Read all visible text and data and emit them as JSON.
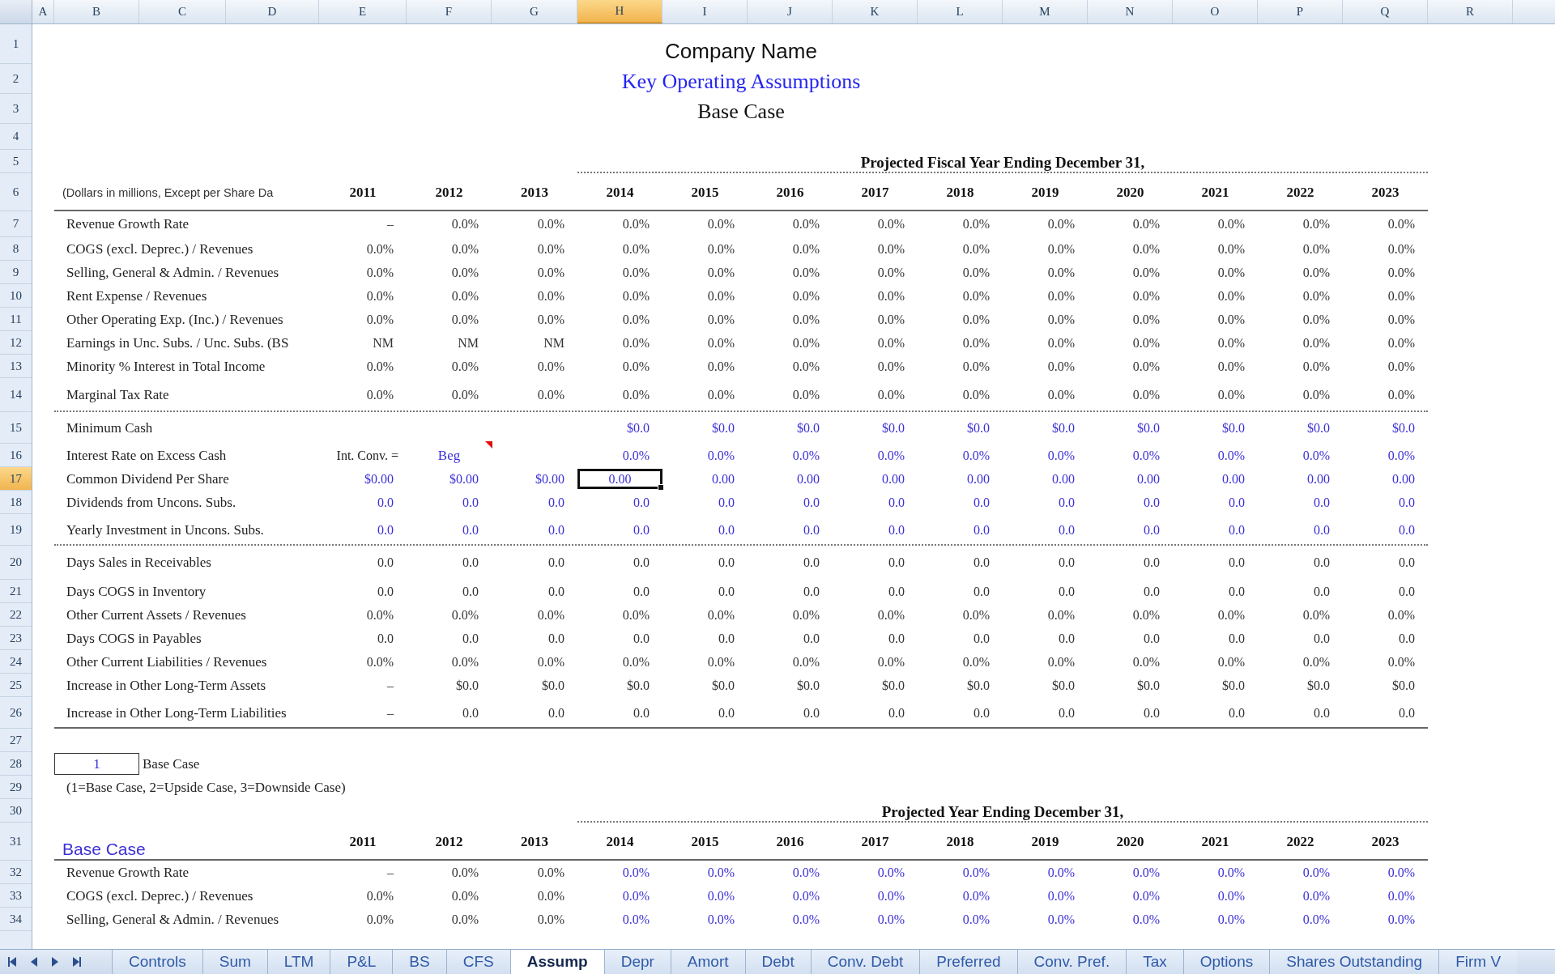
{
  "columns": [
    {
      "letter": "A",
      "selected": false
    },
    {
      "letter": "B",
      "selected": false
    },
    {
      "letter": "C",
      "selected": false
    },
    {
      "letter": "D",
      "selected": false
    },
    {
      "letter": "E",
      "selected": false
    },
    {
      "letter": "F",
      "selected": false
    },
    {
      "letter": "G",
      "selected": false
    },
    {
      "letter": "H",
      "selected": true
    },
    {
      "letter": "I",
      "selected": false
    },
    {
      "letter": "J",
      "selected": false
    },
    {
      "letter": "K",
      "selected": false
    },
    {
      "letter": "L",
      "selected": false
    },
    {
      "letter": "M",
      "selected": false
    },
    {
      "letter": "N",
      "selected": false
    },
    {
      "letter": "O",
      "selected": false
    },
    {
      "letter": "P",
      "selected": false
    },
    {
      "letter": "Q",
      "selected": false
    },
    {
      "letter": "R",
      "selected": false
    }
  ],
  "rows": [
    {
      "number": "1",
      "selected": false,
      "kind": "company",
      "text": "Company Name"
    },
    {
      "number": "2",
      "selected": false,
      "kind": "heading",
      "text": "Key Operating Assumptions"
    },
    {
      "number": "3",
      "selected": false,
      "kind": "case",
      "text": "Base Case"
    },
    {
      "number": "4",
      "selected": false,
      "kind": "blank"
    },
    {
      "number": "5",
      "selected": false,
      "kind": "band",
      "text": "Projected Fiscal Year Ending December 31,"
    },
    {
      "number": "6",
      "selected": false,
      "kind": "years",
      "label": "(Dollars in millions, Except per Share Da",
      "years": [
        "2011",
        "2012",
        "2013",
        "2014",
        "2015",
        "2016",
        "2017",
        "2018",
        "2019",
        "2020",
        "2021",
        "2022",
        "2023"
      ]
    },
    {
      "number": "7",
      "selected": false,
      "kind": "data",
      "label": "Revenue Growth Rate",
      "history_input": false,
      "projected_input": false,
      "history": [
        "–",
        "0.0%",
        "0.0%"
      ],
      "projected": [
        "0.0%",
        "0.0%",
        "0.0%",
        "0.0%",
        "0.0%",
        "0.0%",
        "0.0%",
        "0.0%",
        "0.0%",
        "0.0%"
      ]
    },
    {
      "number": "8",
      "selected": false,
      "kind": "data",
      "label": "COGS (excl. Deprec.) / Revenues",
      "history_input": false,
      "projected_input": false,
      "history": [
        "0.0%",
        "0.0%",
        "0.0%"
      ],
      "projected": [
        "0.0%",
        "0.0%",
        "0.0%",
        "0.0%",
        "0.0%",
        "0.0%",
        "0.0%",
        "0.0%",
        "0.0%",
        "0.0%"
      ]
    },
    {
      "number": "9",
      "selected": false,
      "kind": "data",
      "label": "Selling, General & Admin. / Revenues",
      "history_input": false,
      "projected_input": false,
      "history": [
        "0.0%",
        "0.0%",
        "0.0%"
      ],
      "projected": [
        "0.0%",
        "0.0%",
        "0.0%",
        "0.0%",
        "0.0%",
        "0.0%",
        "0.0%",
        "0.0%",
        "0.0%",
        "0.0%"
      ]
    },
    {
      "number": "10",
      "selected": false,
      "kind": "data",
      "label": "Rent Expense / Revenues",
      "history_input": false,
      "projected_input": false,
      "history": [
        "0.0%",
        "0.0%",
        "0.0%"
      ],
      "projected": [
        "0.0%",
        "0.0%",
        "0.0%",
        "0.0%",
        "0.0%",
        "0.0%",
        "0.0%",
        "0.0%",
        "0.0%",
        "0.0%"
      ]
    },
    {
      "number": "11",
      "selected": false,
      "kind": "data",
      "label": "Other Operating Exp. (Inc.) / Revenues",
      "history_input": false,
      "projected_input": false,
      "history": [
        "0.0%",
        "0.0%",
        "0.0%"
      ],
      "projected": [
        "0.0%",
        "0.0%",
        "0.0%",
        "0.0%",
        "0.0%",
        "0.0%",
        "0.0%",
        "0.0%",
        "0.0%",
        "0.0%"
      ]
    },
    {
      "number": "12",
      "selected": false,
      "kind": "data",
      "label": "Earnings in Unc. Subs. / Unc. Subs. (BS",
      "history_input": false,
      "projected_input": false,
      "history": [
        "NM",
        "NM",
        "NM"
      ],
      "projected": [
        "0.0%",
        "0.0%",
        "0.0%",
        "0.0%",
        "0.0%",
        "0.0%",
        "0.0%",
        "0.0%",
        "0.0%",
        "0.0%"
      ]
    },
    {
      "number": "13",
      "selected": false,
      "kind": "data",
      "label": "Minority % Interest in Total Income",
      "history_input": false,
      "projected_input": false,
      "history": [
        "0.0%",
        "0.0%",
        "0.0%"
      ],
      "projected": [
        "0.0%",
        "0.0%",
        "0.0%",
        "0.0%",
        "0.0%",
        "0.0%",
        "0.0%",
        "0.0%",
        "0.0%",
        "0.0%"
      ]
    },
    {
      "number": "14",
      "selected": false,
      "kind": "data",
      "rule_below": true,
      "rule_dotted": true,
      "label": "Marginal Tax Rate",
      "history_input": false,
      "projected_input": false,
      "history": [
        "0.0%",
        "0.0%",
        "0.0%"
      ],
      "projected": [
        "0.0%",
        "0.0%",
        "0.0%",
        "0.0%",
        "0.0%",
        "0.0%",
        "0.0%",
        "0.0%",
        "0.0%",
        "0.0%"
      ]
    },
    {
      "number": "15",
      "selected": false,
      "kind": "data",
      "label": "Minimum Cash",
      "projected_input": true,
      "projected": [
        "$0.0",
        "$0.0",
        "$0.0",
        "$0.0",
        "$0.0",
        "$0.0",
        "$0.0",
        "$0.0",
        "$0.0",
        "$0.0"
      ]
    },
    {
      "number": "16",
      "selected": false,
      "kind": "convention",
      "label": "Interest Rate on Excess Cash",
      "convention_label": "Int. Conv. =",
      "convention_value": "Beg",
      "comment": true,
      "projected_input": true,
      "projected": [
        "0.0%",
        "0.0%",
        "0.0%",
        "0.0%",
        "0.0%",
        "0.0%",
        "0.0%",
        "0.0%",
        "0.0%",
        "0.0%"
      ]
    },
    {
      "number": "17",
      "selected": true,
      "kind": "data",
      "label": "Common Dividend Per Share",
      "history_input": true,
      "projected_input": true,
      "history": [
        "$0.00",
        "$0.00",
        "$0.00"
      ],
      "projected": [
        "0.00",
        "0.00",
        "0.00",
        "0.00",
        "0.00",
        "0.00",
        "0.00",
        "0.00",
        "0.00",
        "0.00"
      ]
    },
    {
      "number": "18",
      "selected": false,
      "kind": "data",
      "label": "Dividends from Uncons. Subs.",
      "history_input": true,
      "projected_input": true,
      "history": [
        "0.0",
        "0.0",
        "0.0"
      ],
      "projected": [
        "0.0",
        "0.0",
        "0.0",
        "0.0",
        "0.0",
        "0.0",
        "0.0",
        "0.0",
        "0.0",
        "0.0"
      ]
    },
    {
      "number": "19",
      "selected": false,
      "kind": "data",
      "rule_below": true,
      "rule_dotted": true,
      "label": "Yearly Investment in Uncons. Subs.",
      "history_input": true,
      "projected_input": true,
      "history": [
        "0.0",
        "0.0",
        "0.0"
      ],
      "projected": [
        "0.0",
        "0.0",
        "0.0",
        "0.0",
        "0.0",
        "0.0",
        "0.0",
        "0.0",
        "0.0",
        "0.0"
      ]
    },
    {
      "number": "20",
      "selected": false,
      "kind": "data",
      "label": "Days Sales in Receivables",
      "history_input": false,
      "projected_input": false,
      "history": [
        "0.0",
        "0.0",
        "0.0"
      ],
      "projected": [
        "0.0",
        "0.0",
        "0.0",
        "0.0",
        "0.0",
        "0.0",
        "0.0",
        "0.0",
        "0.0",
        "0.0"
      ]
    },
    {
      "number": "21",
      "selected": false,
      "kind": "data",
      "label": "Days COGS in Inventory",
      "history_input": false,
      "projected_input": false,
      "history": [
        "0.0",
        "0.0",
        "0.0"
      ],
      "projected": [
        "0.0",
        "0.0",
        "0.0",
        "0.0",
        "0.0",
        "0.0",
        "0.0",
        "0.0",
        "0.0",
        "0.0"
      ]
    },
    {
      "number": "22",
      "selected": false,
      "kind": "data",
      "label": "Other Current Assets / Revenues",
      "history_input": false,
      "projected_input": false,
      "history": [
        "0.0%",
        "0.0%",
        "0.0%"
      ],
      "projected": [
        "0.0%",
        "0.0%",
        "0.0%",
        "0.0%",
        "0.0%",
        "0.0%",
        "0.0%",
        "0.0%",
        "0.0%",
        "0.0%"
      ]
    },
    {
      "number": "23",
      "selected": false,
      "kind": "data",
      "label": "Days COGS in Payables",
      "history_input": false,
      "projected_input": false,
      "history": [
        "0.0",
        "0.0",
        "0.0"
      ],
      "projected": [
        "0.0",
        "0.0",
        "0.0",
        "0.0",
        "0.0",
        "0.0",
        "0.0",
        "0.0",
        "0.0",
        "0.0"
      ]
    },
    {
      "number": "24",
      "selected": false,
      "kind": "data",
      "label": "Other Current Liabilities / Revenues",
      "history_input": false,
      "projected_input": false,
      "history": [
        "0.0%",
        "0.0%",
        "0.0%"
      ],
      "projected": [
        "0.0%",
        "0.0%",
        "0.0%",
        "0.0%",
        "0.0%",
        "0.0%",
        "0.0%",
        "0.0%",
        "0.0%",
        "0.0%"
      ]
    },
    {
      "number": "25",
      "selected": false,
      "kind": "data",
      "label": "Increase in Other Long-Term Assets",
      "history_input": false,
      "projected_input": false,
      "history": [
        "–",
        "$0.0",
        "$0.0"
      ],
      "projected": [
        "$0.0",
        "$0.0",
        "$0.0",
        "$0.0",
        "$0.0",
        "$0.0",
        "$0.0",
        "$0.0",
        "$0.0",
        "$0.0"
      ]
    },
    {
      "number": "26",
      "selected": false,
      "kind": "data",
      "rule_below": true,
      "rule_dotted": false,
      "label": "Increase in Other Long-Term Liabilities",
      "history_input": false,
      "projected_input": false,
      "history": [
        "–",
        "0.0",
        "0.0"
      ],
      "projected": [
        "0.0",
        "0.0",
        "0.0",
        "0.0",
        "0.0",
        "0.0",
        "0.0",
        "0.0",
        "0.0",
        "0.0"
      ]
    },
    {
      "number": "27",
      "selected": false,
      "kind": "blank"
    },
    {
      "number": "28",
      "selected": false,
      "kind": "case_input",
      "value": "1",
      "label": "Base Case"
    },
    {
      "number": "29",
      "selected": false,
      "kind": "note",
      "note": "(1=Base Case, 2=Upside Case, 3=Downside Case)"
    },
    {
      "number": "30",
      "selected": false,
      "kind": "band",
      "text": "Projected Year Ending December 31,"
    },
    {
      "number": "31",
      "selected": false,
      "kind": "case_years",
      "label": "Base Case",
      "years": [
        "2011",
        "2012",
        "2013",
        "2014",
        "2015",
        "2016",
        "2017",
        "2018",
        "2019",
        "2020",
        "2021",
        "2022",
        "2023"
      ]
    },
    {
      "number": "32",
      "selected": false,
      "kind": "data",
      "label": "Revenue Growth Rate",
      "history_input": false,
      "projected_input": true,
      "history": [
        "–",
        "0.0%",
        "0.0%"
      ],
      "projected": [
        "0.0%",
        "0.0%",
        "0.0%",
        "0.0%",
        "0.0%",
        "0.0%",
        "0.0%",
        "0.0%",
        "0.0%",
        "0.0%"
      ]
    },
    {
      "number": "33",
      "selected": false,
      "kind": "data",
      "label": "COGS (excl. Deprec.) / Revenues",
      "history_input": false,
      "projected_input": true,
      "history": [
        "0.0%",
        "0.0%",
        "0.0%"
      ],
      "projected": [
        "0.0%",
        "0.0%",
        "0.0%",
        "0.0%",
        "0.0%",
        "0.0%",
        "0.0%",
        "0.0%",
        "0.0%",
        "0.0%"
      ]
    },
    {
      "number": "34",
      "selected": false,
      "kind": "data",
      "label": "Selling, General & Admin. / Revenues",
      "history_input": false,
      "projected_input": true,
      "history": [
        "0.0%",
        "0.0%",
        "0.0%"
      ],
      "projected": [
        "0.0%",
        "0.0%",
        "0.0%",
        "0.0%",
        "0.0%",
        "0.0%",
        "0.0%",
        "0.0%",
        "0.0%",
        "0.0%"
      ]
    }
  ],
  "sheet_tabs": [
    {
      "label": "Controls",
      "selected": false
    },
    {
      "label": "Sum",
      "selected": false
    },
    {
      "label": "LTM",
      "selected": false
    },
    {
      "label": "P&L",
      "selected": false
    },
    {
      "label": "BS",
      "selected": false
    },
    {
      "label": "CFS",
      "selected": false
    },
    {
      "label": "Assump",
      "selected": true
    },
    {
      "label": "Depr",
      "selected": false
    },
    {
      "label": "Amort",
      "selected": false
    },
    {
      "label": "Debt",
      "selected": false
    },
    {
      "label": "Conv. Debt",
      "selected": false
    },
    {
      "label": "Preferred",
      "selected": false
    },
    {
      "label": "Conv. Pref.",
      "selected": false
    },
    {
      "label": "Tax",
      "selected": false
    },
    {
      "label": "Options",
      "selected": false
    },
    {
      "label": "Shares Outstanding",
      "selected": false
    },
    {
      "label": "Firm V",
      "selected": false
    }
  ]
}
